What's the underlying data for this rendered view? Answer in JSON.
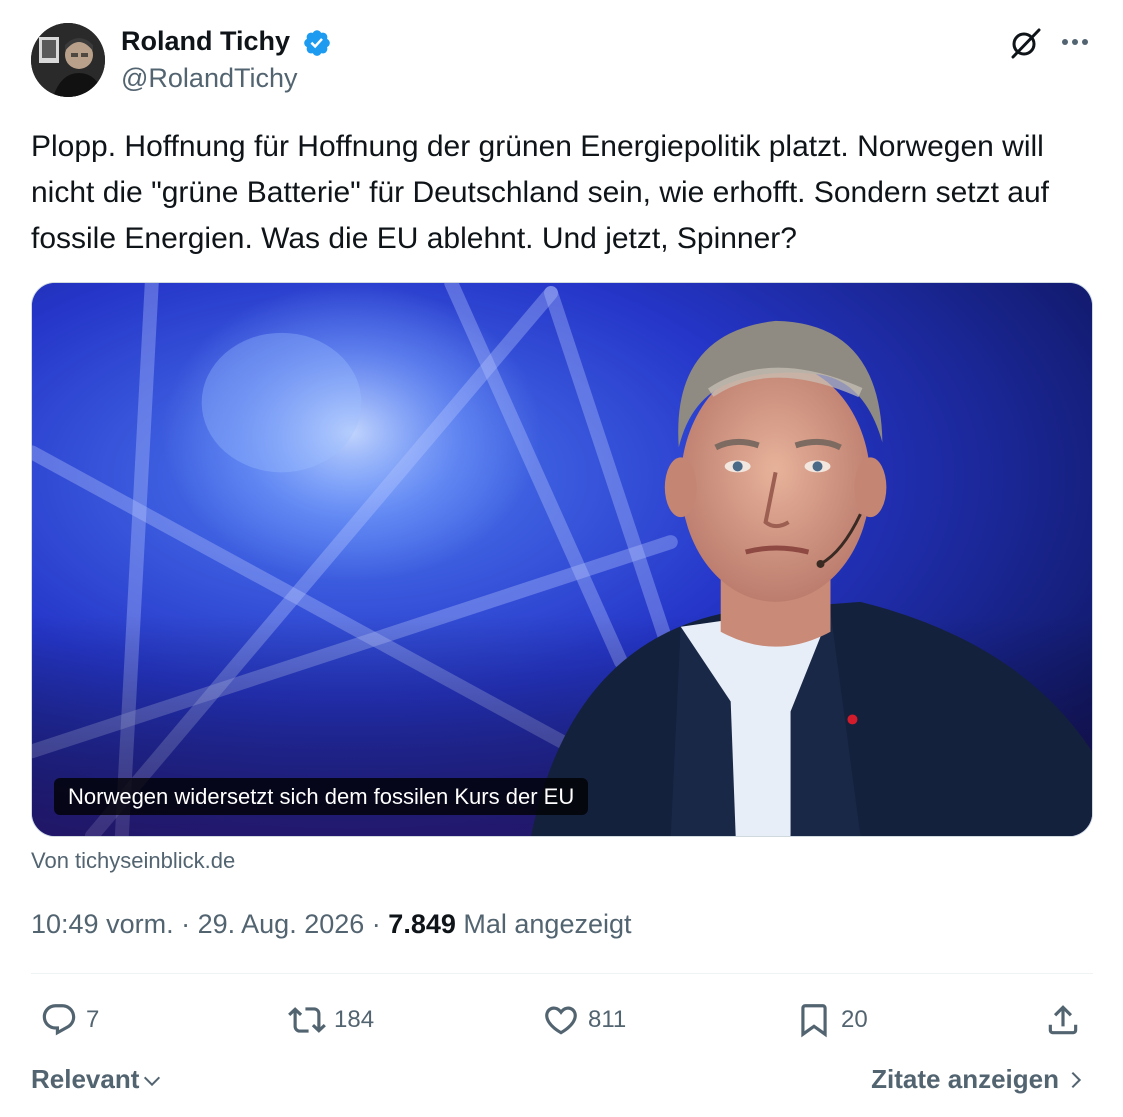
{
  "author": {
    "name": "Roland Tichy",
    "handle": "@RolandTichy",
    "verified": true
  },
  "tweet": {
    "text": "Plopp. Hoffnung für Hoffnung der grünen Energiepolitik platzt. Norwegen will nicht die \"grüne Batterie\" für Deutschland sein, wie erhofft. Sondern setzt auf fossile Energien. Was die EU ablehnt. Und jetzt, Spinner?"
  },
  "card": {
    "caption": "Norwegen widersetzt sich dem fossilen Kurs der EU",
    "source": "Von tichyseinblick.de"
  },
  "meta": {
    "time": "10:49 vorm.",
    "separator": "·",
    "date": "29. Aug. 2026",
    "views": "7.849",
    "views_label": "Mal angezeigt"
  },
  "actions": {
    "replies": "7",
    "reposts": "184",
    "likes": "811",
    "bookmarks": "20"
  },
  "footer": {
    "sort_label": "Relevant",
    "quotes_label": "Zitate anzeigen"
  },
  "colors": {
    "text_primary": "#0f1419",
    "text_secondary": "#536471",
    "verified_blue": "#1d9bf0",
    "divider": "#eff3f4"
  },
  "icons": {
    "verified": "verified-badge-icon",
    "grok": "grok-icon",
    "more": "more-dots-icon",
    "reply": "reply-icon",
    "repost": "repost-icon",
    "like": "heart-icon",
    "bookmark": "bookmark-icon",
    "share": "share-icon",
    "sort": "chevron-down-icon",
    "quotes": "chevron-right-icon"
  }
}
